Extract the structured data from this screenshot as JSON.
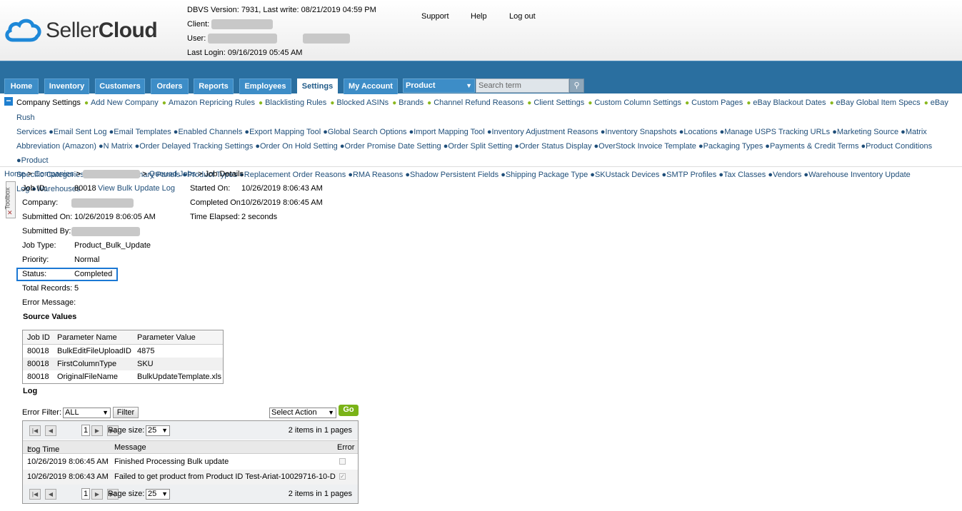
{
  "header": {
    "logo_text_a": "Seller",
    "logo_text_b": "Cloud",
    "dbvs": "DBVS Version: 7931, Last write: 08/21/2019 04:59 PM",
    "client_label": "Client:",
    "user_label": "User:",
    "last_login": "Last Login: 09/16/2019 05:45 AM",
    "links": [
      "Support",
      "Help",
      "Log out"
    ]
  },
  "nav": {
    "tabs": [
      "Home",
      "Inventory",
      "Customers",
      "Orders",
      "Reports",
      "Employees",
      "Settings",
      "My Account"
    ],
    "active_tab": "Settings",
    "product_select": "Product",
    "search_placeholder": "Search term"
  },
  "settings_menu": {
    "lines": [
      "Company Settings ● Add New Company ● Amazon Repricing Rules ● Blacklisting Rules ● Blocked ASINs ● Brands ● Channel Refund Reasons ● Client Settings ● Custom Column Settings ● Custom Pages ● eBay Blackout Dates ● eBay Global Item Specs ● eBay Rush",
      "Services ● Email Sent Log ● Email Templates ● Enabled Channels ● Export Mapping Tool ● Global Search Options ● Import Mapping Tool ● Inventory Adjustment Reasons ● Inventory Snapshots ● Locations ● Manage USPS Tracking URLs ● Marketing Source ● Matrix",
      "Abbreviation (Amazon) ● N Matrix ● Order Delayed Tracking Settings ● Order On Hold Setting ● Order Promise Date Setting ● Order Split Setting ● Order Status Display ● OverStock Invoice Template ● Packaging Types ● Payments & Credit Terms ● Product Conditions ● Product",
      "Specific Categories ● Product Summary Panels ● Product Types ● Replacement Order Reasons ● RMA Reasons ● Shadow Persistent Fields ● Shipping Package Type ● SKUstack Devices ● SMTP Profiles ● Tax Classes ● Vendors ● Warehouse Inventory Update",
      "Log ● Warehouses"
    ]
  },
  "breadcrumb": {
    "home": "Home",
    "sep": ">",
    "companies": "Companies",
    "queued_jobs": "Queued Jobs",
    "current": "Job Details"
  },
  "toolbox_label": "Toolbox",
  "job": {
    "job_id_label": "Job ID:",
    "job_id": "80018",
    "view_log_link": "View Bulk Update Log",
    "company_label": "Company:",
    "submitted_on_label": "Submitted On:",
    "submitted_on": "10/26/2019 8:06:05 AM",
    "submitted_by_label": "Submitted By:",
    "job_type_label": "Job Type:",
    "job_type": "Product_Bulk_Update",
    "priority_label": "Priority:",
    "priority": "Normal",
    "status_label": "Status:",
    "status": "Completed",
    "total_records_label": "Total Records:",
    "total_records": "5",
    "error_message_label": "Error Message:",
    "started_on_label": "Started On:",
    "started_on": "10/26/2019 8:06:43 AM",
    "completed_on_label": "Completed On:",
    "completed_on": "10/26/2019 8:06:45 AM",
    "time_elapsed_label": "Time Elapsed:",
    "time_elapsed": "2 seconds"
  },
  "source_values": {
    "title": "Source Values",
    "columns": [
      "Job ID",
      "Parameter Name",
      "Parameter Value"
    ],
    "rows": [
      [
        "80018",
        "BulkEditFileUploadID",
        "4875"
      ],
      [
        "80018",
        "FirstColumnType",
        "SKU"
      ],
      [
        "80018",
        "OriginalFileName",
        "BulkUpdateTemplate.xls"
      ]
    ]
  },
  "log": {
    "title": "Log",
    "error_filter_label": "Error Filter:",
    "error_filter_value": "ALL",
    "filter_button": "Filter",
    "select_action": "Select Action",
    "go_button": "Go",
    "page_number": "1",
    "page_size_label": "Page size:",
    "page_size": "25",
    "items_summary": "2 items in 1 pages",
    "columns": [
      "Log Time",
      "Message",
      "Error"
    ],
    "rows": [
      {
        "time": "10/26/2019 8:06:45 AM",
        "message": "Finished Processing Bulk update",
        "error": false
      },
      {
        "time": "10/26/2019 8:06:43 AM",
        "message": "Failed to get product from Product ID Test-Ariat-10029716-10-D",
        "error": true
      }
    ]
  },
  "colors": {
    "nav_bar": "#2a6fa0",
    "tab": "#3d8dc7",
    "link": "#1f4e79",
    "bullet": "#8ab81e",
    "status_highlight": "#1b78d4",
    "go_button": "#7ab317"
  }
}
